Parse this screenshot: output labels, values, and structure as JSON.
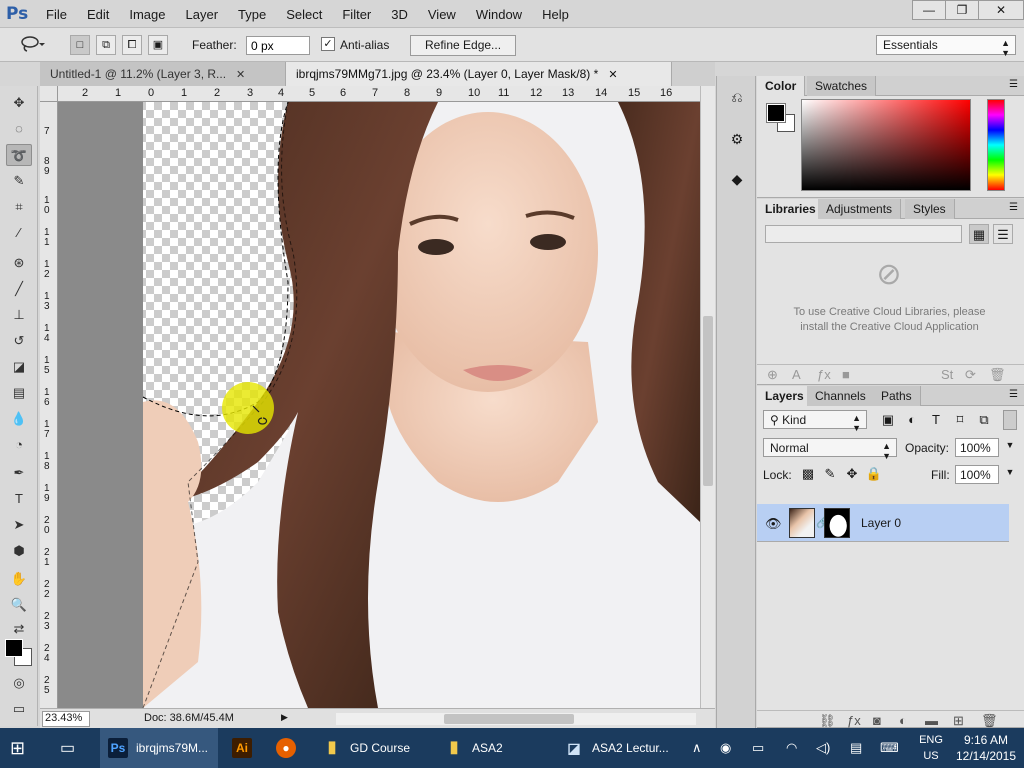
{
  "menu": {
    "logo": "Ps",
    "items": [
      "File",
      "Edit",
      "Image",
      "Layer",
      "Type",
      "Select",
      "Filter",
      "3D",
      "View",
      "Window",
      "Help"
    ],
    "minimize": "—",
    "restore": "❐",
    "close": "✕"
  },
  "options": {
    "feather_label": "Feather:",
    "feather_value": "0 px",
    "antialias_label": "Anti-alias",
    "antialias_checked": "✓",
    "refine_label": "Refine Edge...",
    "workspace": "Essentials"
  },
  "tabs": [
    {
      "label": "Untitled-1 @ 11.2% (Layer 3, R...",
      "close": "✕"
    },
    {
      "label": "ibrqjms79MMg71.jpg @ 23.4% (Layer 0, Layer Mask/8) *",
      "close": "✕"
    }
  ],
  "ruler": {
    "top": [
      "2",
      "1",
      "0",
      "1",
      "2",
      "3",
      "4",
      "5",
      "6",
      "7",
      "8",
      "9",
      "10",
      "11",
      "12",
      "13",
      "14",
      "15",
      "16"
    ],
    "left": [
      "7",
      "8",
      "9",
      "1 0",
      "1 1",
      "1 2",
      "1 3",
      "1 4",
      "1 5",
      "1 6",
      "1 7",
      "1 8",
      "1 9",
      "2 0",
      "2 1",
      "2 2",
      "2 3",
      "2 4",
      "2 5"
    ]
  },
  "status": {
    "zoom": "23.43%",
    "doc": "Doc: 38.6M/45.4M"
  },
  "color_panel": {
    "tabs": [
      "Color",
      "Swatches"
    ]
  },
  "libraries_panel": {
    "tabs": [
      "Libraries",
      "Adjustments",
      "Styles"
    ],
    "message": "To use Creative Cloud Libraries, please install the Creative Cloud Application"
  },
  "layers_panel": {
    "tabs": [
      "Layers",
      "Channels",
      "Paths"
    ],
    "filter": "Kind",
    "blend_mode": "Normal",
    "opacity_label": "Opacity:",
    "opacity_value": "100%",
    "lock_label": "Lock:",
    "fill_label": "Fill:",
    "fill_value": "100%",
    "layers": [
      {
        "name": "Layer 0"
      }
    ]
  },
  "taskbar": {
    "items": [
      {
        "label": "ibrqjms79M...",
        "icon": "Ps"
      },
      {
        "label": "",
        "icon": "Ai"
      },
      {
        "label": "",
        "icon": "firefox-icon"
      },
      {
        "label": "GD Course",
        "icon": "folder-icon"
      },
      {
        "label": "ASA2",
        "icon": "folder-icon"
      },
      {
        "label": "ASA2 Lectur...",
        "icon": "document-icon"
      }
    ],
    "lang_top": "ENG",
    "lang_bottom": "US",
    "time": "9:16 AM",
    "date": "12/14/2015"
  },
  "colors": {
    "ps_blue": "#2d5fa8",
    "selection_highlight": "#b8cff3",
    "taskbar": "#1b3b5e",
    "cursor_highlight": "#e6e600"
  }
}
